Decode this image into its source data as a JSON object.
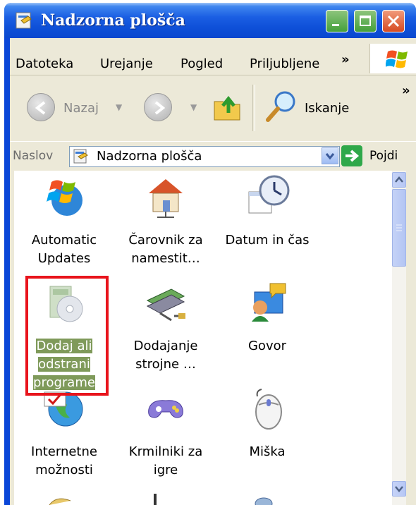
{
  "window": {
    "title": "Nadzorna plošča",
    "accent": "#0a46d8"
  },
  "menu": {
    "items": [
      "Datoteka",
      "Urejanje",
      "Pogled",
      "Priljubljene"
    ],
    "more": "»"
  },
  "toolbar": {
    "back_label": "Nazaj",
    "search_label": "Iskanje",
    "more": "»"
  },
  "address": {
    "label": "Naslov",
    "value": "Nadzorna plošča",
    "go_label": "Pojdi"
  },
  "items": [
    {
      "label_line1": "Automatic",
      "label_line2": "Updates",
      "icon": "windows-update-icon"
    },
    {
      "label_line1": "Čarovnik za",
      "label_line2": "namestit…",
      "icon": "network-setup-icon"
    },
    {
      "label_line1": "Datum in čas",
      "label_line2": "",
      "icon": "date-time-icon"
    },
    {
      "label_line1": "Dodaj ali",
      "label_line2": "odstrani",
      "label_line3": "programe",
      "icon": "add-remove-programs-icon",
      "selected": true
    },
    {
      "label_line1": "Dodajanje",
      "label_line2": "strojne …",
      "icon": "add-hardware-icon"
    },
    {
      "label_line1": "Govor",
      "label_line2": "",
      "icon": "speech-icon"
    },
    {
      "label_line1": "Internetne",
      "label_line2": "možnosti",
      "icon": "internet-options-icon"
    },
    {
      "label_line1": "Krmilniki za",
      "label_line2": "igre",
      "icon": "game-controllers-icon"
    },
    {
      "label_line1": "Miška",
      "label_line2": "",
      "icon": "mouse-icon"
    }
  ],
  "highlight_color": "#e8141c"
}
